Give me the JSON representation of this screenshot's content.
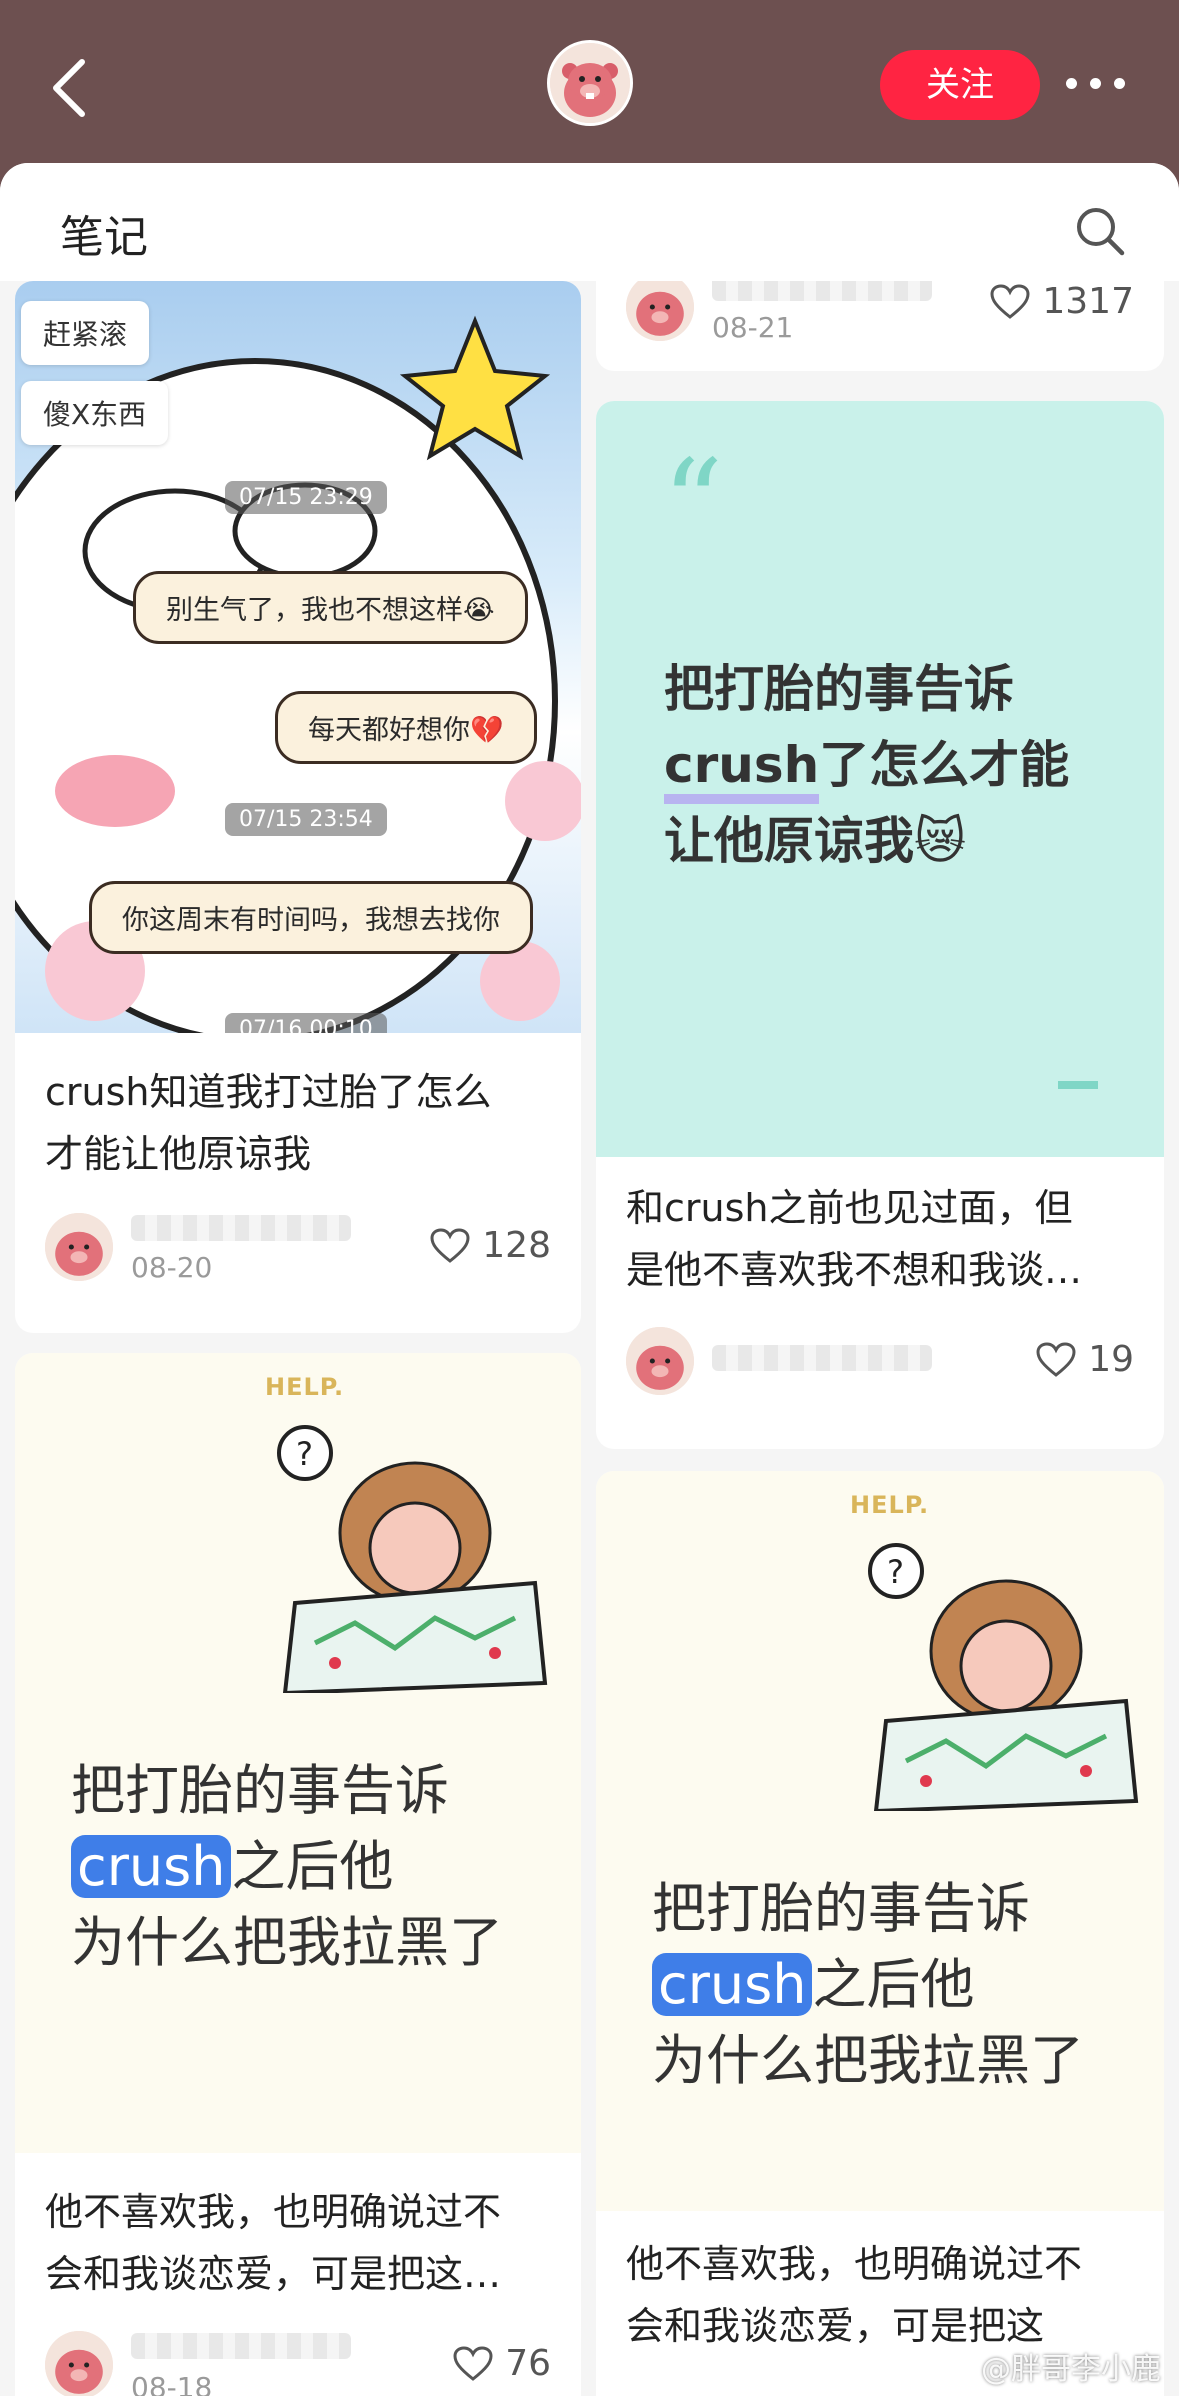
{
  "header": {
    "follow_label": "关注"
  },
  "sheet": {
    "title": "笔记"
  },
  "cards": {
    "top_right": {
      "date": "08-21",
      "likes": "1317"
    },
    "chat_card": {
      "tags": [
        "赶紧滚",
        "傻X东西"
      ],
      "timestamps": [
        "07/15 23:29",
        "07/15 23:54",
        "07/16 00:10"
      ],
      "bubbles": [
        "别生气了，我也不想这样😭",
        "每天都好想你💔",
        "你这周末有时间吗，我想去找你"
      ],
      "title_line1": "crush知道我打过胎了怎么",
      "title_line2": "才能让他原谅我",
      "date": "08-20",
      "likes": "128"
    },
    "quote_card": {
      "line1": "把打胎的事告诉",
      "line2_hl": "crush",
      "line2_rest": "了怎么才能",
      "line3": "让他原谅我😿",
      "title_line1": "和crush之前也见过面，但",
      "title_line2": "是他不喜欢我不想和我谈…",
      "likes": "19"
    },
    "help_card_left": {
      "help": "HELP.",
      "line1": "把打胎的事告诉",
      "line2_hl": "crush",
      "line2_rest": "之后他",
      "line3": "为什么把我拉黑了",
      "title_line1": "他不喜欢我，也明确说过不",
      "title_line2": "会和我谈恋爱，可是把这…",
      "date": "08-18",
      "likes": "76"
    },
    "help_card_right": {
      "help": "HELP.",
      "line1": "把打胎的事告诉",
      "line2_hl": "crush",
      "line2_rest": "之后他",
      "line3": "为什么把我拉黑了",
      "title_line1": "他不喜欢我，也明确说过不",
      "title_line2": "会和我谈恋爱，可是把这"
    }
  },
  "watermark": "@胖哥李小鹿",
  "colors": {
    "topbar": "#6d5050",
    "follow": "#ff2442",
    "quote_bg": "#c9f1ea",
    "highlight": "#3f7ee8"
  }
}
